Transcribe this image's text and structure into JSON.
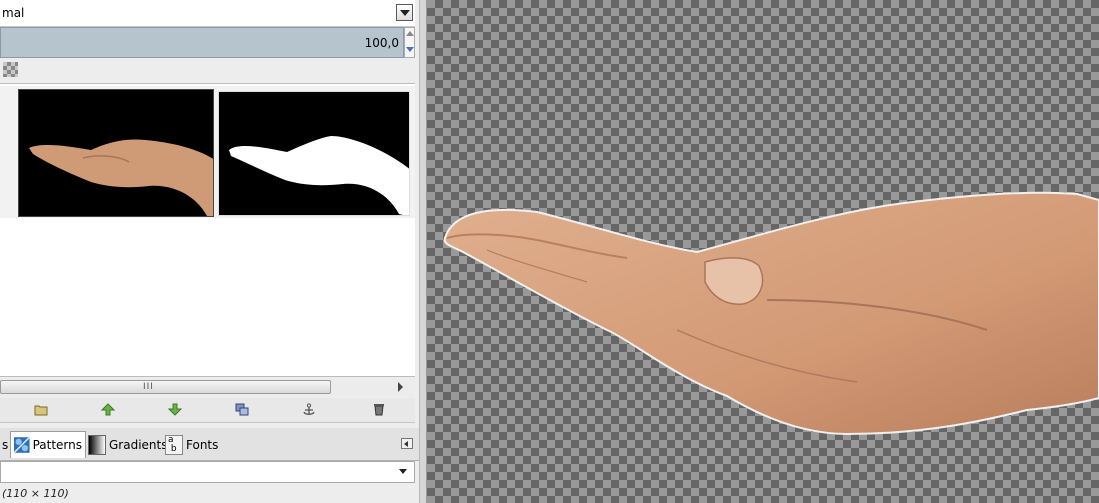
{
  "layers_panel": {
    "mode_label": "mal",
    "opacity_value": "100,0",
    "icons": [
      "chevron-down-icon",
      "lock-alpha-icon",
      "new-layer-group-icon",
      "raise-layer-icon",
      "lower-layer-icon",
      "duplicate-layer-icon",
      "anchor-layer-icon",
      "delete-layer-icon"
    ],
    "scroll_grip": "III"
  },
  "dock_tabs": {
    "partial_label": "s",
    "patterns_label": "Patterns",
    "gradients_label": "Gradients",
    "fonts_label": "Fonts"
  },
  "patterns": {
    "size_label": "(110 × 110)"
  },
  "colors": {
    "opacity_bar": "#b5c4cd",
    "skin": "#d9a27e"
  }
}
